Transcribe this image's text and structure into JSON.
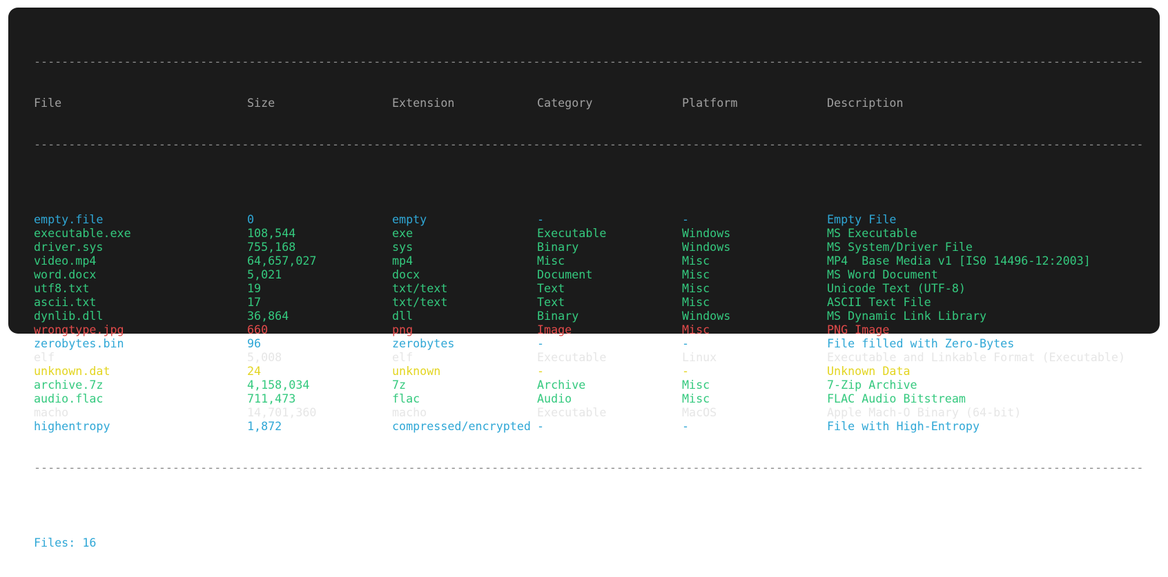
{
  "colors": {
    "cyan": "#2fa7d6",
    "green": "#34c97e",
    "red": "#e24a4a",
    "white": "#e6e6e6",
    "yellow": "#e3d521",
    "gray": "#a0a0a0"
  },
  "separator": "--------------------------------------------------------------------------------------------------------------------------------------------------------------------------------------",
  "headers": {
    "file": "File",
    "size": "Size",
    "extension": "Extension",
    "category": "Category",
    "platform": "Platform",
    "description": "Description"
  },
  "rows": [
    {
      "file": "empty.file",
      "size": "0",
      "extension": "empty",
      "category": "-",
      "platform": "-",
      "description": "Empty File",
      "color": "cyan"
    },
    {
      "file": "executable.exe",
      "size": "108,544",
      "extension": "exe",
      "category": "Executable",
      "platform": "Windows",
      "description": "MS Executable",
      "color": "green"
    },
    {
      "file": "driver.sys",
      "size": "755,168",
      "extension": "sys",
      "category": "Binary",
      "platform": "Windows",
      "description": "MS System/Driver File",
      "color": "green"
    },
    {
      "file": "video.mp4",
      "size": "64,657,027",
      "extension": "mp4",
      "category": "Misc",
      "platform": "Misc",
      "description": "MP4  Base Media v1 [IS0 14496-12:2003]",
      "color": "green"
    },
    {
      "file": "word.docx",
      "size": "5,021",
      "extension": "docx",
      "category": "Document",
      "platform": "Misc",
      "description": "MS Word Document",
      "color": "green"
    },
    {
      "file": "utf8.txt",
      "size": "19",
      "extension": "txt/text",
      "category": "Text",
      "platform": "Misc",
      "description": "Unicode Text (UTF-8)",
      "color": "green"
    },
    {
      "file": "ascii.txt",
      "size": "17",
      "extension": "txt/text",
      "category": "Text",
      "platform": "Misc",
      "description": "ASCII Text File",
      "color": "green"
    },
    {
      "file": "dynlib.dll",
      "size": "36,864",
      "extension": "dll",
      "category": "Binary",
      "platform": "Windows",
      "description": "MS Dynamic Link Library",
      "color": "green"
    },
    {
      "file": "wrongtype.jpg",
      "size": "660",
      "extension": "png",
      "category": "Image",
      "platform": "Misc",
      "description": "PNG Image",
      "color": "red"
    },
    {
      "file": "zerobytes.bin",
      "size": "96",
      "extension": "zerobytes",
      "category": "-",
      "platform": "-",
      "description": "File filled with Zero-Bytes",
      "color": "cyan"
    },
    {
      "file": "elf",
      "size": "5,008",
      "extension": "elf",
      "category": "Executable",
      "platform": "Linux",
      "description": "Executable and Linkable Format (Executable)",
      "color": "white"
    },
    {
      "file": "unknown.dat",
      "size": "24",
      "extension": "unknown",
      "category": "-",
      "platform": "-",
      "description": "Unknown Data",
      "color": "yellow"
    },
    {
      "file": "archive.7z",
      "size": "4,158,034",
      "extension": "7z",
      "category": "Archive",
      "platform": "Misc",
      "description": "7-Zip Archive",
      "color": "green"
    },
    {
      "file": "audio.flac",
      "size": "711,473",
      "extension": "flac",
      "category": "Audio",
      "platform": "Misc",
      "description": "FLAC Audio Bitstream",
      "color": "green"
    },
    {
      "file": "macho",
      "size": "14,701,360",
      "extension": "macho",
      "category": "Executable",
      "platform": "MacOS",
      "description": "Apple Mach-O Binary (64-bit)",
      "color": "white"
    },
    {
      "file": "highentropy",
      "size": "1,872",
      "extension": "compressed/encrypted",
      "category": "-",
      "platform": "-",
      "description": "File with High-Entropy",
      "color": "cyan"
    }
  ],
  "footer": {
    "label": "Files: 16"
  }
}
